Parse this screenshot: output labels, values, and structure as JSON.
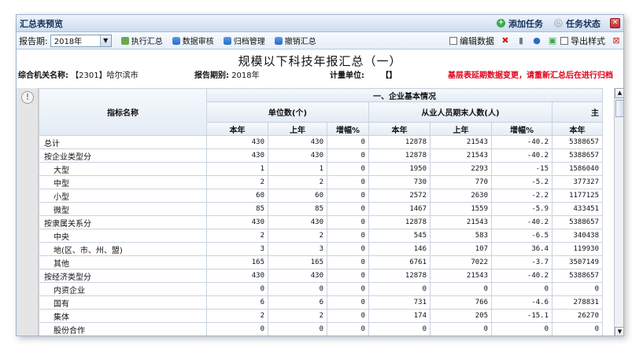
{
  "window": {
    "title": "汇总表预览"
  },
  "titlebar_actions": [
    {
      "label": "添加任务",
      "icon": "add-circle-icon"
    },
    {
      "label": "任务状态",
      "icon": "clock-icon"
    }
  ],
  "toolbar": {
    "period_label": "报告期:",
    "period_value": "2018年",
    "tools": [
      {
        "label": "执行汇总",
        "icon": "execute-summary-icon"
      },
      {
        "label": "数据审核",
        "icon": "database-icon"
      },
      {
        "label": "归档管理",
        "icon": "database-icon"
      },
      {
        "label": "撤销汇总",
        "icon": "database-icon"
      }
    ],
    "edit_data_label": "编辑数据",
    "export_style_label": "导出样式"
  },
  "report": {
    "title": "规模以下科技年报汇总（一）",
    "org_label": "综合机关名称:",
    "org_value": "【2301】哈尔滨市",
    "period_label": "报告期别:",
    "period_value": "2018年",
    "unit_label": "计量单位:",
    "unit_value": "【】",
    "warning": "基层表延期数据变更，请重新汇总后在进行归档"
  },
  "table": {
    "index_header": "指标名称",
    "group_header": "一、企业基本情况",
    "sub_headers": [
      "单位数(个)",
      "从业人员期末人数(人)",
      "主"
    ],
    "col_headers": [
      "本年",
      "上年",
      "增幅%",
      "本年",
      "上年",
      "增幅%",
      "本年"
    ],
    "rows": [
      {
        "name": "总计",
        "sub": false,
        "v": [
          "430",
          "430",
          "0",
          "12878",
          "21543",
          "-40.2",
          "5388657"
        ]
      },
      {
        "name": "按企业类型分",
        "sub": false,
        "v": [
          "430",
          "430",
          "0",
          "12878",
          "21543",
          "-40.2",
          "5388657"
        ]
      },
      {
        "name": "大型",
        "sub": true,
        "v": [
          "1",
          "1",
          "0",
          "1950",
          "2293",
          "-15",
          "1586040"
        ]
      },
      {
        "name": "中型",
        "sub": true,
        "v": [
          "2",
          "2",
          "0",
          "730",
          "770",
          "-5.2",
          "377327"
        ]
      },
      {
        "name": "小型",
        "sub": true,
        "v": [
          "60",
          "60",
          "0",
          "2572",
          "2630",
          "-2.2",
          "1177125"
        ]
      },
      {
        "name": "微型",
        "sub": true,
        "v": [
          "85",
          "85",
          "0",
          "1467",
          "1559",
          "-5.9",
          "433451"
        ]
      },
      {
        "name": "按隶属关系分",
        "sub": false,
        "v": [
          "430",
          "430",
          "0",
          "12878",
          "21543",
          "-40.2",
          "5388657"
        ]
      },
      {
        "name": "中央",
        "sub": true,
        "v": [
          "2",
          "2",
          "0",
          "545",
          "583",
          "-6.5",
          "340438"
        ]
      },
      {
        "name": "地(区、市、州、盟)",
        "sub": true,
        "v": [
          "3",
          "3",
          "0",
          "146",
          "107",
          "36.4",
          "119930"
        ]
      },
      {
        "name": "其他",
        "sub": true,
        "v": [
          "165",
          "165",
          "0",
          "6761",
          "7022",
          "-3.7",
          "3507149"
        ]
      },
      {
        "name": "按经济类型分",
        "sub": false,
        "v": [
          "430",
          "430",
          "0",
          "12878",
          "21543",
          "-40.2",
          "5388657"
        ]
      },
      {
        "name": "内资企业",
        "sub": true,
        "v": [
          "0",
          "0",
          "0",
          "0",
          "0",
          "0",
          "0"
        ]
      },
      {
        "name": "国有",
        "sub": true,
        "v": [
          "6",
          "6",
          "0",
          "731",
          "766",
          "-4.6",
          "278831"
        ]
      },
      {
        "name": "集体",
        "sub": true,
        "v": [
          "2",
          "2",
          "0",
          "174",
          "205",
          "-15.1",
          "26270"
        ]
      },
      {
        "name": "股份合作",
        "sub": true,
        "v": [
          "0",
          "0",
          "0",
          "0",
          "0",
          "0",
          "0"
        ]
      }
    ]
  }
}
